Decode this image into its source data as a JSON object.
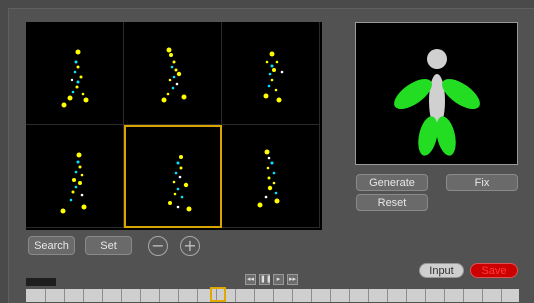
{
  "buttons": {
    "search": "Search",
    "set": "Set",
    "minus": "−",
    "plus": "+",
    "generate": "Generate",
    "fix": "Fix",
    "reset": "Reset",
    "input": "Input",
    "save": "Save"
  },
  "player": {
    "rewind": "◂◂",
    "pause": "❚❚",
    "play": "▸",
    "forward": "▸▸"
  },
  "colors": {
    "selection": "#d9a400",
    "skeleton_joint": "#ffff00",
    "skeleton_bone": "#00e5ff",
    "model_limb": "#22dd22",
    "model_body": "#d0d0d0",
    "save_button": "#cc0000"
  },
  "selected_thumbnail": 5
}
